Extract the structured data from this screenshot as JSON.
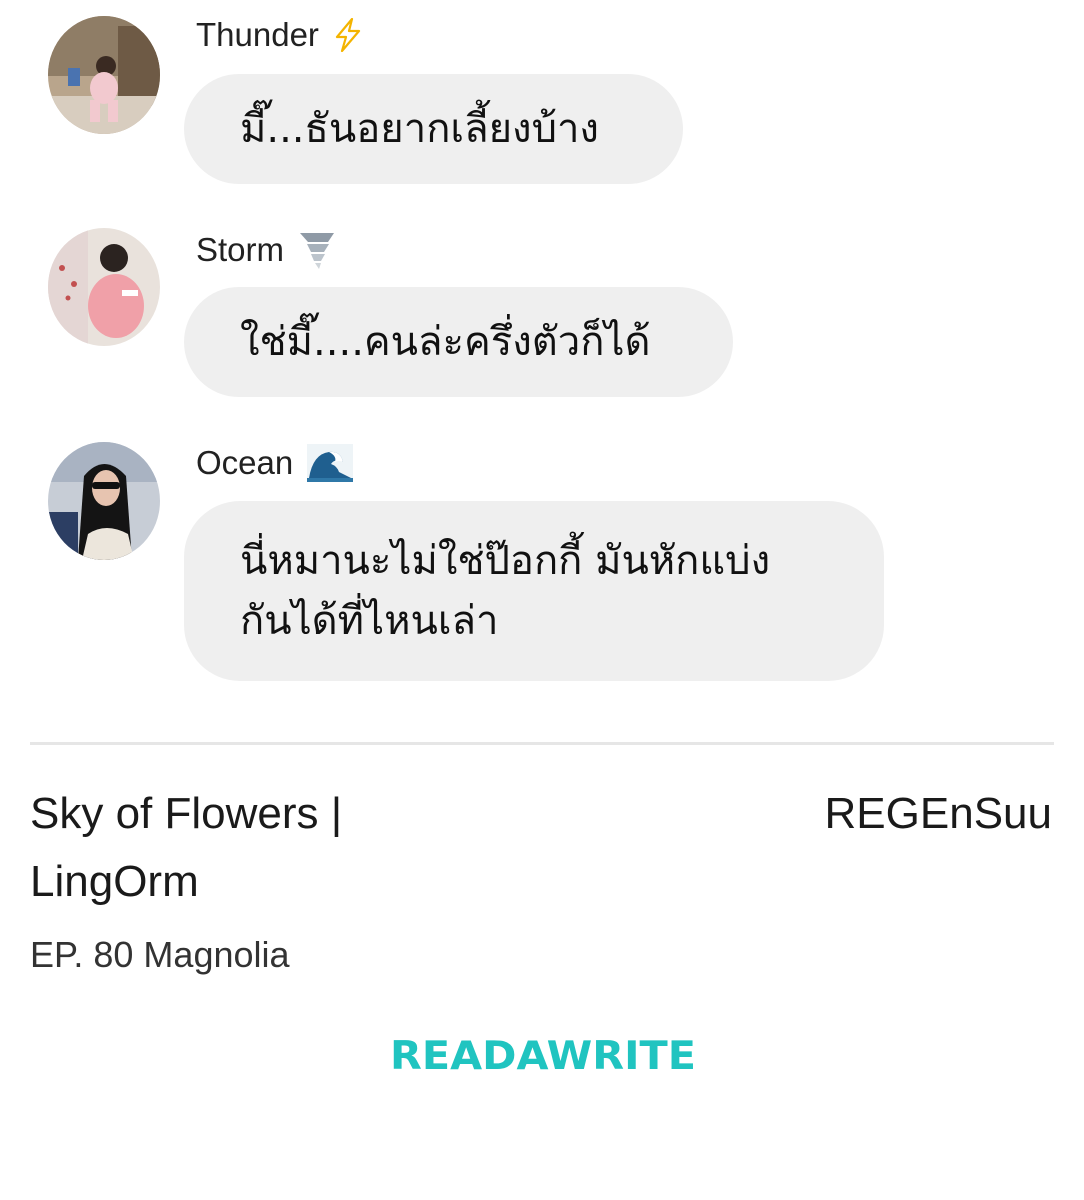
{
  "messages": [
    {
      "sender": "Thunder",
      "sender_emoji": "lightning-icon",
      "text": "มี๊...ธันอยากเลี้ยงบ้าง"
    },
    {
      "sender": "Storm",
      "sender_emoji": "tornado-icon",
      "text": "ใช่มี๊....คนล่ะครึ่งตัวก็ได้"
    },
    {
      "sender": "Ocean",
      "sender_emoji": "wave-icon",
      "text_line1": "นี่หมานะไม่ใช่ป๊อกกี้ มันหักแบ่ง",
      "text_line2": "กันได้ที่ไหนเล่า"
    }
  ],
  "story": {
    "title_line1": "Sky of Flowers |",
    "title_line2": "LingOrm",
    "author": "REGEnSuu",
    "episode": "EP. 80 Magnolia"
  },
  "brand": {
    "logo_text": "READAWRITE",
    "color": "#20c4c0"
  },
  "colors": {
    "bubble": "#efefef",
    "divider": "#e6e6e6"
  }
}
